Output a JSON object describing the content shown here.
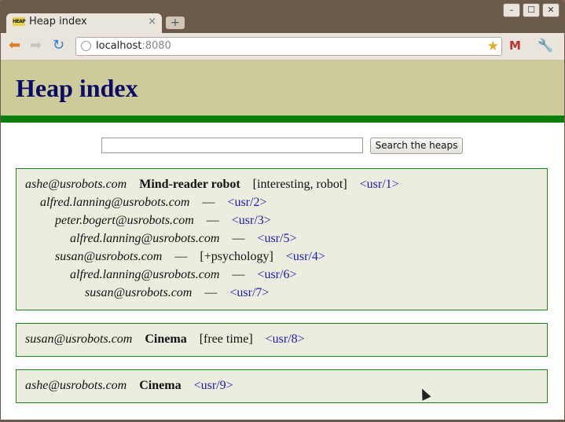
{
  "browser": {
    "tab_title": "Heap index",
    "favicon_text": "HEAP",
    "tab_close": "×",
    "new_tab": "+",
    "window_buttons": [
      "–",
      "☐",
      "✕"
    ],
    "url_host": "localhost",
    "url_port": ":8080"
  },
  "page": {
    "heading": "Heap index",
    "search_placeholder": "",
    "search_button": "Search the heaps"
  },
  "heaps": [
    {
      "items": [
        {
          "author": "ashe@usrobots.com",
          "title": "Mind-reader robot",
          "tags": "[interesting, robot]",
          "link": "<usr/1>",
          "indent": 0
        },
        {
          "author": "alfred.lanning@usrobots.com",
          "dash": "—",
          "link": "<usr/2>",
          "indent": 1
        },
        {
          "author": "peter.bogert@usrobots.com",
          "dash": "—",
          "link": "<usr/3>",
          "indent": 2
        },
        {
          "author": "alfred.lanning@usrobots.com",
          "dash": "—",
          "link": "<usr/5>",
          "indent": 3
        },
        {
          "author": "susan@usrobots.com",
          "dash": "—",
          "tags": "[+psychology]",
          "link": "<usr/4>",
          "indent": 2
        },
        {
          "author": "alfred.lanning@usrobots.com",
          "dash": "—",
          "link": "<usr/6>",
          "indent": 3
        },
        {
          "author": "susan@usrobots.com",
          "dash": "—",
          "link": "<usr/7>",
          "indent": 4
        }
      ]
    },
    {
      "items": [
        {
          "author": "susan@usrobots.com",
          "title": "Cinema",
          "tags": "[free time]",
          "link": "<usr/8>",
          "indent": 0
        }
      ]
    },
    {
      "items": [
        {
          "author": "ashe@usrobots.com",
          "title": "Cinema",
          "link": "<usr/9>",
          "indent": 0
        }
      ]
    }
  ]
}
